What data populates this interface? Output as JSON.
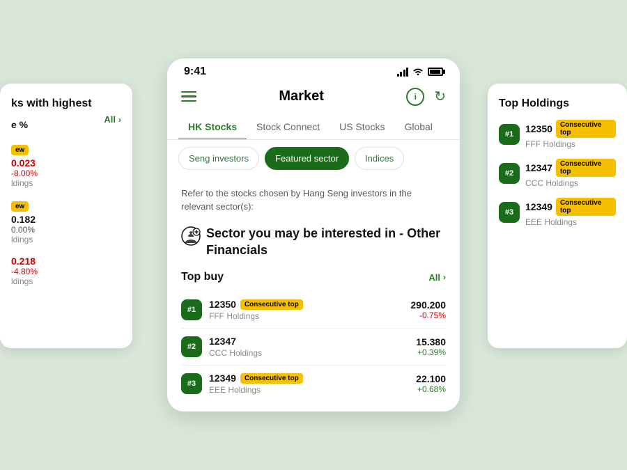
{
  "statusBar": {
    "time": "9:41"
  },
  "header": {
    "title": "Market",
    "info_label": "i",
    "refresh_label": "↻"
  },
  "tabs": [
    {
      "label": "HK Stocks",
      "active": true
    },
    {
      "label": "Stock Connect",
      "active": false
    },
    {
      "label": "US Stocks",
      "active": false
    },
    {
      "label": "Global",
      "active": false
    }
  ],
  "subTabs": [
    {
      "label": "Seng investors",
      "active": false
    },
    {
      "label": "Featured sector",
      "active": true
    },
    {
      "label": "Indices",
      "active": false
    }
  ],
  "description": "Refer to the stocks chosen by Hang Seng investors in the relevant sector(s):",
  "sectorTitle": "Sector you may be interested in - Other Financials",
  "topBuy": {
    "title": "Top buy",
    "allLabel": "All",
    "stocks": [
      {
        "rank": "#1",
        "code": "12350",
        "badge": "Consecutive top",
        "name": "FFF Holdings",
        "price": "290.200",
        "change": "-0.75%",
        "changeType": "negative"
      },
      {
        "rank": "#2",
        "code": "12347",
        "badge": null,
        "name": "CCC Holdings",
        "price": "15.380",
        "change": "+0.39%",
        "changeType": "positive"
      },
      {
        "rank": "#3",
        "code": "12349",
        "badge": "Consecutive top",
        "name": "EEE Holdings",
        "price": "22.100",
        "change": "+0.68%",
        "changeType": "positive"
      }
    ]
  },
  "leftCard": {
    "title": "ks with highest",
    "subtitle": "e %",
    "allLabel": "All",
    "stocks": [
      {
        "badge": "ew",
        "name": "ldings",
        "price": "0.023",
        "change": "-8.00%",
        "changeType": "negative"
      },
      {
        "badge": "ew",
        "name": "ldings",
        "price": "0.182",
        "change": "0.00%",
        "changeType": "neutral"
      },
      {
        "badge": null,
        "name": "ldings",
        "price": "0.218",
        "change": "-4.80%",
        "changeType": "negative"
      }
    ]
  },
  "rightCard": {
    "title": "Top Holdings",
    "stocks": [
      {
        "rank": "#1",
        "code": "12350",
        "badge": "Consecutive top",
        "name": "FFF Holdings"
      },
      {
        "rank": "#2",
        "code": "12347",
        "badge": "Consecutive top",
        "name": "CCC Holdings"
      },
      {
        "rank": "#3",
        "code": "12349",
        "badge": "Consecutive top",
        "name": "EEE Holdings"
      }
    ]
  },
  "colors": {
    "green": "#2d7a2d",
    "darkGreen": "#1a6b1a",
    "yellow": "#f5c000",
    "red": "#cc0000",
    "bg": "#d9e8d9"
  }
}
